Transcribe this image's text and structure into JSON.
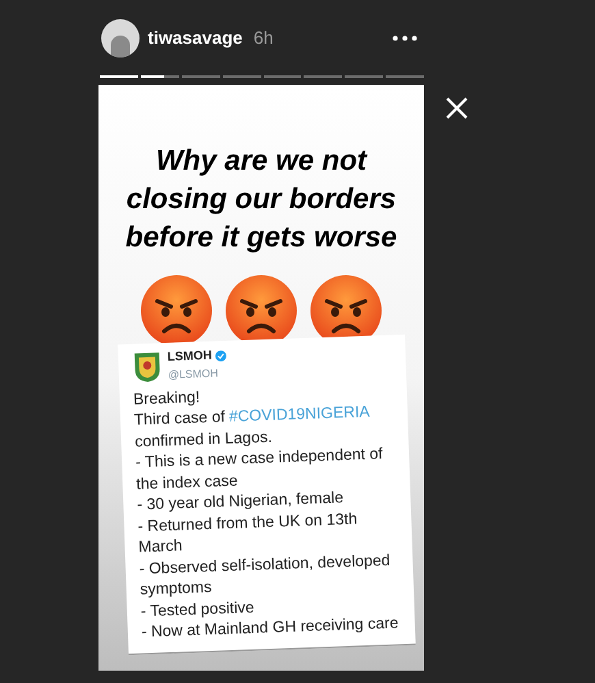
{
  "header": {
    "username": "tiwasavage",
    "time": "6h"
  },
  "progress": [
    {
      "kind": "seen"
    },
    {
      "kind": "current",
      "level": 0.6
    },
    {
      "kind": "unseen"
    },
    {
      "kind": "unseen"
    },
    {
      "kind": "unseen"
    },
    {
      "kind": "unseen"
    },
    {
      "kind": "unseen"
    },
    {
      "kind": "unseen"
    }
  ],
  "story": {
    "headline": "Why are we not closing our borders before it gets worse",
    "emojis": [
      {
        "kind": "angry"
      },
      {
        "kind": "angry"
      },
      {
        "kind": "angry"
      }
    ],
    "tweet": {
      "name": "LSMOH",
      "handle": "@LSMOH",
      "verified": true,
      "lines": [
        "Breaking!",
        {
          "text": "Third case of",
          "link": "#COVID19NIGERIA"
        },
        "confirmed in Lagos.",
        "- This is a new case independent of",
        "the index case",
        "- 30 year old Nigerian, female",
        "- Returned from the UK on 13th",
        "March",
        "- Observed self-isolation, developed",
        "symptoms",
        "- Tested positive",
        "- Now at Mainland GH receiving care"
      ]
    }
  }
}
